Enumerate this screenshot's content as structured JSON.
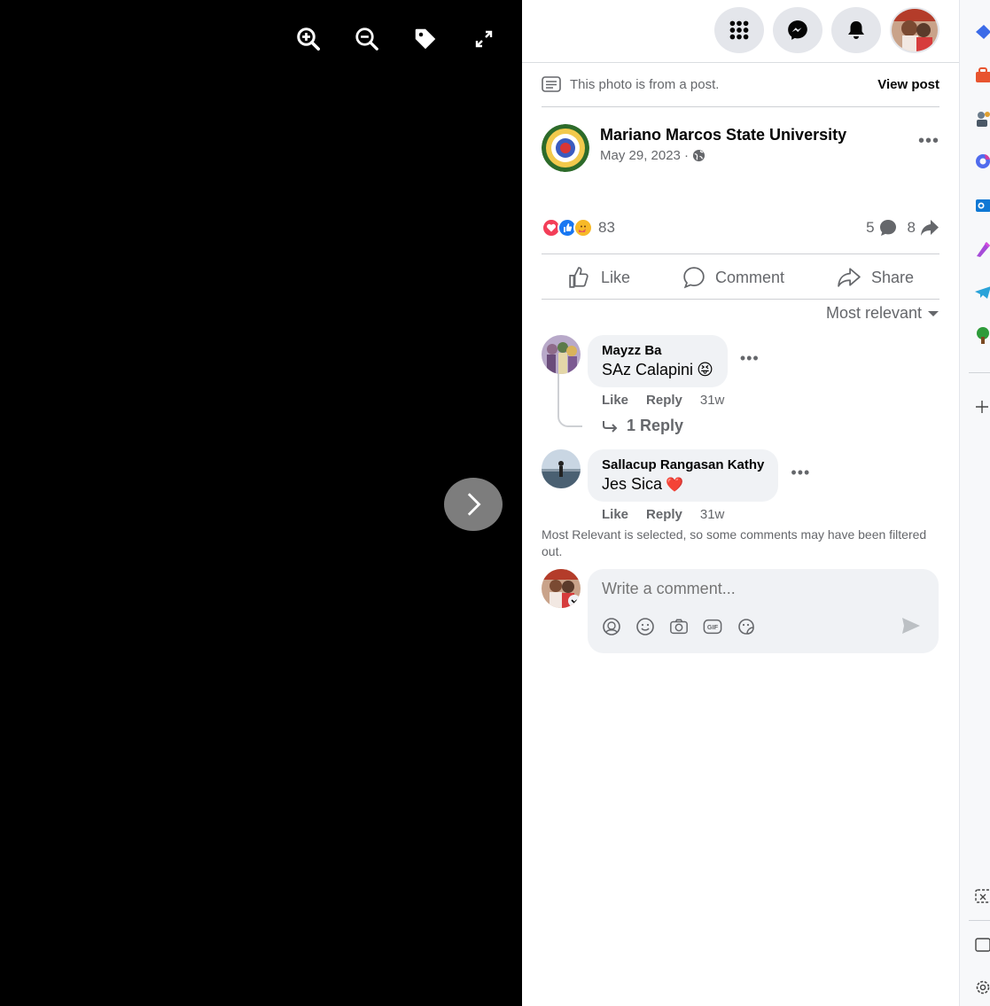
{
  "viewer": {
    "tools": [
      "zoom-in-icon",
      "zoom-out-icon",
      "tag-icon",
      "fullscreen-icon"
    ],
    "next_icon": "chevron-right-icon"
  },
  "topbar": {
    "icons": [
      "menu-grid-icon",
      "messenger-icon",
      "notifications-bell-icon"
    ],
    "profile": "profile-avatar"
  },
  "post_note": {
    "text": "This photo is from a post.",
    "view_post": "View post"
  },
  "poster": {
    "name": "Mariano Marcos State University",
    "date": "May 29, 2023 · ",
    "privacy_icon": "globe-icon",
    "more": "•••"
  },
  "stats": {
    "reactions": [
      "love",
      "like",
      "care"
    ],
    "reaction_count": "83",
    "comments": "5",
    "shares": "8"
  },
  "actions": {
    "like": "Like",
    "comment": "Comment",
    "share": "Share"
  },
  "sort": {
    "label": "Most relevant"
  },
  "comments": [
    {
      "name": "Mayzz Ba",
      "text": "SAz Calapini",
      "emoji": "😝",
      "like": "Like",
      "reply": "Reply",
      "time": "31w",
      "replies": "1 Reply",
      "more": "•••"
    },
    {
      "name": "Sallacup Rangasan Kathy",
      "text": "Jes Sica",
      "emoji": "❤️",
      "like": "Like",
      "reply": "Reply",
      "time": "31w",
      "more": "•••"
    }
  ],
  "filter_note": "Most Relevant is selected, so some comments may have been filtered out.",
  "composer": {
    "placeholder": "Write a comment...",
    "icons": [
      "avatar-sticker-icon",
      "emoji-icon",
      "camera-icon",
      "gif-icon",
      "sticker-icon"
    ],
    "send_icon": "send-icon"
  },
  "colors": {
    "viewer_bg": "#000000",
    "button_bg": "#e4e6eb",
    "bubble_bg": "#f0f2f5",
    "secondary_text": "#65676b",
    "like_blue": "#1877f2",
    "love_red": "#f33e58"
  }
}
